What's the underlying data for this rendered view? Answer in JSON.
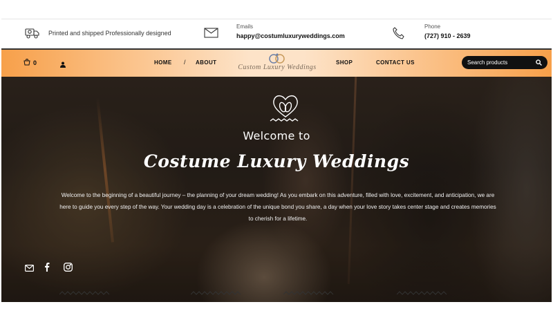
{
  "topbar": {
    "tagline": "Printed and shipped Professionally designed",
    "email_label": "Emails",
    "email_value": "happy@costumluxuryweddings.com",
    "phone_label": "Phone",
    "phone_value": "(727) 910 - 2639"
  },
  "nav": {
    "cart_count": "0",
    "links": [
      "HOME",
      "ABOUT",
      "SHOP",
      "CONTACT US"
    ],
    "separator": "/",
    "logo_text": "Custom Luxury Weddings",
    "search_placeholder": "Search products"
  },
  "hero": {
    "welcome": "Welcome to",
    "title": "Costume Luxury Weddings",
    "paragraph": "Welcome to the beginning of a beautiful journey – the planning of your dream wedding! As you embark on this adventure, filled with love, excitement, and anticipation, we are here to guide you every step of the way. Your wedding day is a celebration of the unique bond you share, a day when your love story takes center stage and creates memories to cherish for a lifetime."
  },
  "icons": {
    "shipping": "truck-icon",
    "email": "envelope-icon",
    "phone": "phone-icon",
    "cart": "cart-icon",
    "user": "user-icon",
    "search": "search-icon",
    "emblem": "rings-heart-icon",
    "socials": [
      "envelope-icon",
      "facebook-icon",
      "instagram-icon"
    ]
  },
  "colors": {
    "nav_accent": "#f7a04a",
    "search_bg": "#111111",
    "hero_text": "#ffffff"
  }
}
